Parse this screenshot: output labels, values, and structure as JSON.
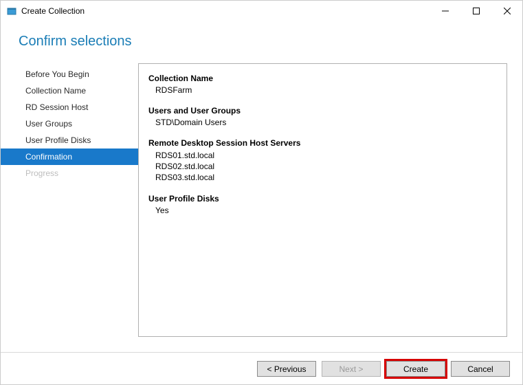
{
  "window": {
    "title": "Create Collection"
  },
  "heading": "Confirm selections",
  "sidebar": {
    "steps": [
      {
        "label": "Before You Begin"
      },
      {
        "label": "Collection Name"
      },
      {
        "label": "RD Session Host"
      },
      {
        "label": "User Groups"
      },
      {
        "label": "User Profile Disks"
      },
      {
        "label": "Confirmation"
      },
      {
        "label": "Progress"
      }
    ]
  },
  "content": {
    "collection_name_label": "Collection Name",
    "collection_name_value": "RDSFarm",
    "users_label": "Users and User Groups",
    "users_value": "STD\\Domain Users",
    "hosts_label": "Remote Desktop Session Host Servers",
    "hosts": [
      "RDS01.std.local",
      "RDS02.std.local",
      "RDS03.std.local"
    ],
    "upd_label": "User Profile Disks",
    "upd_value": "Yes"
  },
  "footer": {
    "previous": "< Previous",
    "next": "Next >",
    "create": "Create",
    "cancel": "Cancel"
  }
}
